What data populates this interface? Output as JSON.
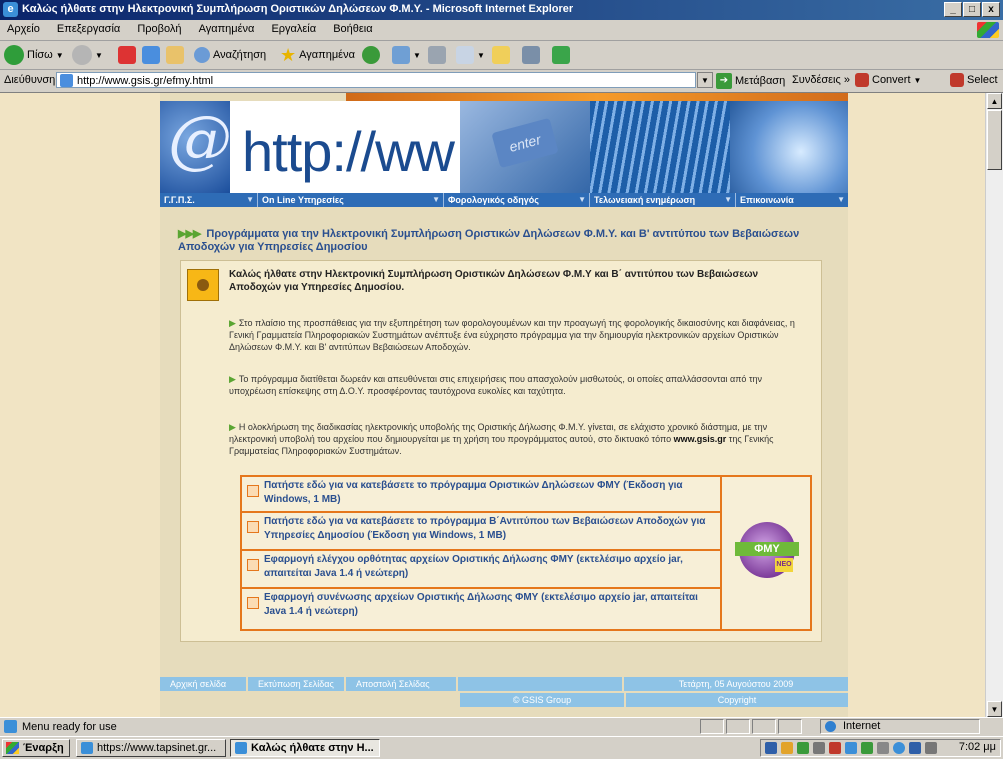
{
  "window": {
    "title": "Καλώς ήλθατε στην Ηλεκτρονική Συμπλήρωση Οριστικών Δηλώσεων Φ.Μ.Υ. - Microsoft Internet Explorer",
    "minimize": "_",
    "maximize": "□",
    "close": "x"
  },
  "menu": {
    "items": [
      "Αρχείο",
      "Επεξεργασία",
      "Προβολή",
      "Αγαπημένα",
      "Εργαλεία",
      "Βοήθεια"
    ]
  },
  "toolbar": {
    "back": "Πίσω",
    "search": "Αναζήτηση",
    "favorites": "Αγαπημένα"
  },
  "address": {
    "label": "Διεύθυνση",
    "url": "http://www.gsis.gr/efmy.html",
    "go": "Μετάβαση",
    "links": "Συνδέσεις",
    "links_more": "»",
    "convert": "Convert",
    "select": "Select"
  },
  "site": {
    "banner_text": "http://ww",
    "enter_key": "enter",
    "nav": [
      {
        "label": "Γ.Γ.Π.Σ."
      },
      {
        "label": "On Line Υπηρεσίες"
      },
      {
        "label": "Φορολογικός οδηγός"
      },
      {
        "label": "Τελωνειακή ενημέρωση"
      },
      {
        "label": "Επικοινωνία"
      }
    ],
    "heading_arrows": "▶▶▶",
    "heading": "Προγράμματα για την Ηλεκτρονική Συμπλήρωση Οριστικών Δηλώσεων Φ.Μ.Υ. και Β' αντιτύπου των Βεβαιώσεων Αποδοχών για Υπηρεσίες Δημοσίου",
    "welcome": "Καλώς ήλθατε στην Ηλεκτρονική Συμπλήρωση Οριστικών Δηλώσεων Φ.Μ.Υ και Β΄ αντιτύπου των Βεβαιώσεων Αποδοχών για Υπηρεσίες Δημοσίου.",
    "para1": "Στο πλαίσιο της προσπάθειας για την εξυπηρέτηση των φορολογουμένων και την προαγωγή της φορολογικής δικαιοσύνης και διαφάνειας, η Γενική Γραμματεία Πληροφοριακών Συστημάτων ανέπτυξε ένα εύχρηστο πρόγραμμα για την δημιουργία ηλεκτρονικών αρχείων Οριστικών Δηλώσεων Φ.Μ.Υ. και Β' αντιτύπων Βεβαιώσεων Αποδοχών.",
    "para2": "Το πρόγραμμα διατίθεται δωρεάν και απευθύνεται στις επιχειρήσεις που απασχολούν μισθωτούς, οι οποίες απαλλάσσονται από την υποχρέωση επίσκεψης στη Δ.Ο.Υ. προσφέροντας ταυτόχρονα ευκολίες και ταχύτητα.",
    "para3_a": "Η ολοκλήρωση της διαδικασίας ηλεκτρονικής υποβολής της Οριστικής Δήλωσης Φ.Μ.Υ. γίνεται, σε ελάχιστο χρονικό διάστημα, με την ηλεκτρονική υποβολή του αρχείου που δημιουργείται με τη χρήση του προγράμματος αυτού, στο δικτυακό τόπο",
    "para3_site": "www.gsis.gr",
    "para3_b": "της Γενικής Γραμματείας Πληροφοριακών Συστημάτων.",
    "downloads": [
      {
        "label": "Πατήστε εδώ για να κατεβάσετε το πρόγραμμα Οριστικών Δηλώσεων ΦΜΥ (Έκδοση για Windows, 1 MB)"
      },
      {
        "label": "Πατήστε εδώ για να κατεβάσετε το πρόγραμμα Β΄Αντιτύπου των Βεβαιώσεων Αποδοχών για Υπηρεσίες Δημοσίου (Έκδοση για Windows, 1 MB)"
      },
      {
        "label": "Εφαρμογή ελέγχου ορθότητας αρχείων Οριστικής Δήλωσης ΦΜΥ (εκτελέσιμο αρχείο jar, απαιτείται Java 1.4 ή νεώτερη)"
      },
      {
        "label": "Εφαρμογή συνένωσης αρχείων Οριστικής Δήλωσης ΦΜΥ (εκτελέσιμο αρχείο jar, απαιτείται Java 1.4 ή νεώτερη)"
      }
    ],
    "fmy_logo": "ΦΜΥ",
    "fmy_neo": "NEO",
    "footer": {
      "home": "Αρχική σελίδα",
      "print": "Εκτύπωση Σελίδας",
      "send": "Αποστολή Σελίδας",
      "date": "Τετάρτη, 05 Αυγούστου 2009",
      "group": "© GSIS Group",
      "copyright": "Copyright"
    }
  },
  "status": {
    "text": "Menu ready for use",
    "zone": "Internet"
  },
  "taskbar": {
    "start": "Έναρξη",
    "tasks": [
      {
        "label": "https://www.tapsinet.gr..."
      },
      {
        "label": "Καλώς ήλθατε στην Η..."
      }
    ],
    "clock": "7:02 μμ"
  }
}
